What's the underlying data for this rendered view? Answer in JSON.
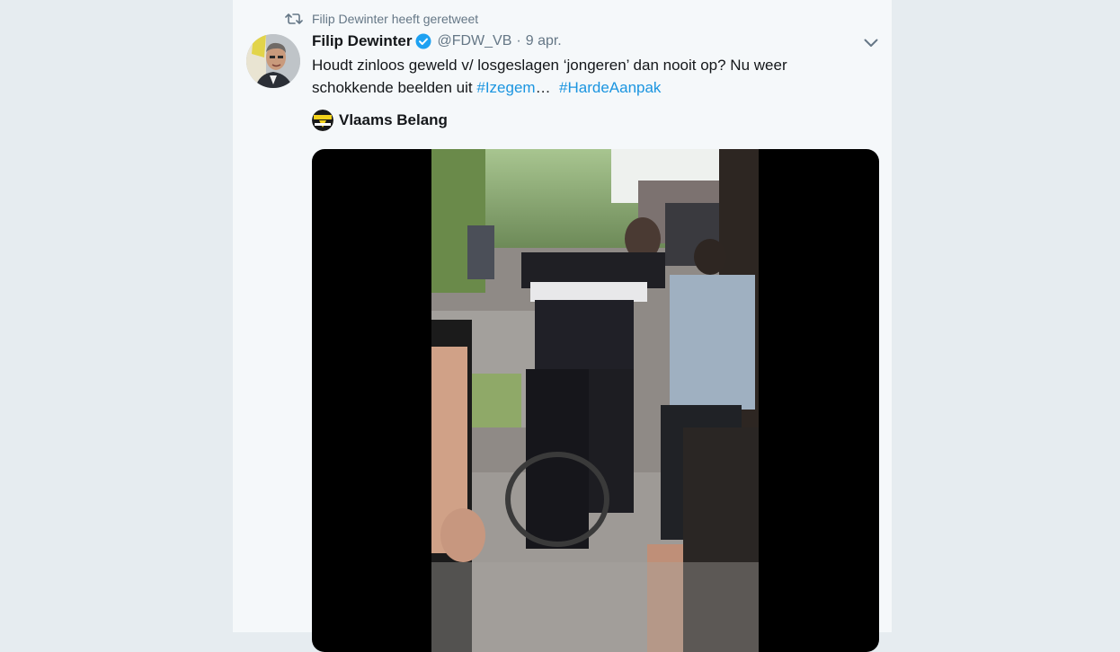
{
  "retweet": {
    "label": "Filip Dewinter heeft geretweet",
    "icon": "retweet-icon"
  },
  "tweet": {
    "author_name": "Filip Dewinter",
    "verified": true,
    "handle": "@FDW_VB",
    "separator": "·",
    "date": "9 apr.",
    "text_line1": "Houdt zinloos geweld v/ losgeslagen ‘jongeren’ dan nooit op? Nu weer",
    "text_line2_prefix": "schokkende beelden uit ",
    "hashtag1": "#Izegem",
    "ellipsis": "…",
    "hashtag2": "#HardeAanpak"
  },
  "quoted": {
    "name": "Vlaams Belang",
    "logo_text_top": "VLAAMS",
    "logo_text_bottom": "BELANG"
  },
  "colors": {
    "link": "#1b95e0",
    "secondary_text": "#657786",
    "primary_text": "#14171a",
    "verified_badge": "#1da1f2",
    "background": "#e6ecf0",
    "card_background": "#f5f8fa"
  }
}
